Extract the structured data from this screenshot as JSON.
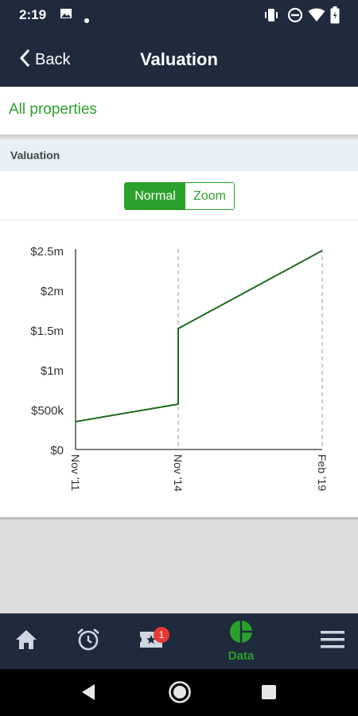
{
  "status_bar": {
    "time": "2:19",
    "icons": [
      "image-icon",
      "dot-icon",
      "vibrate-icon",
      "do-not-disturb-icon",
      "wifi-icon",
      "battery-icon"
    ]
  },
  "header": {
    "back_label": "Back",
    "title": "Valuation"
  },
  "filter": {
    "label": "All properties"
  },
  "section": {
    "title": "Valuation"
  },
  "toggle": {
    "options": [
      "Normal",
      "Zoom"
    ],
    "selected": "Normal"
  },
  "chart_data": {
    "type": "line",
    "x": [
      "Nov '11",
      "Nov '14",
      "Nov '14",
      "Feb '19",
      "Feb '19"
    ],
    "values": [
      350000,
      570000,
      1520000,
      2500000,
      2500000
    ],
    "x_ticks": [
      "Nov '11",
      "Nov '14",
      "Feb '19"
    ],
    "y_ticks": [
      "$0",
      "$500k",
      "$1m",
      "$1.5m",
      "$2m",
      "$2.5m"
    ],
    "ylim": [
      0,
      2500000
    ],
    "line_color": "#1e6b1e",
    "grid": "vertical dashed lines at x ticks"
  },
  "bottom_nav": {
    "items": [
      {
        "icon": "home-icon",
        "label": ""
      },
      {
        "icon": "alarm-icon",
        "label": ""
      },
      {
        "icon": "ticket-star-icon",
        "label": "",
        "badge": "1"
      },
      {
        "icon": "pie-chart-icon",
        "label": "Data",
        "active": true
      },
      {
        "icon": "menu-icon",
        "label": ""
      }
    ]
  },
  "colors": {
    "navy": "#1f2a3d",
    "accent_green": "#2ba12b",
    "section_bg": "#e6f0f6",
    "badge_red": "#e53935"
  }
}
